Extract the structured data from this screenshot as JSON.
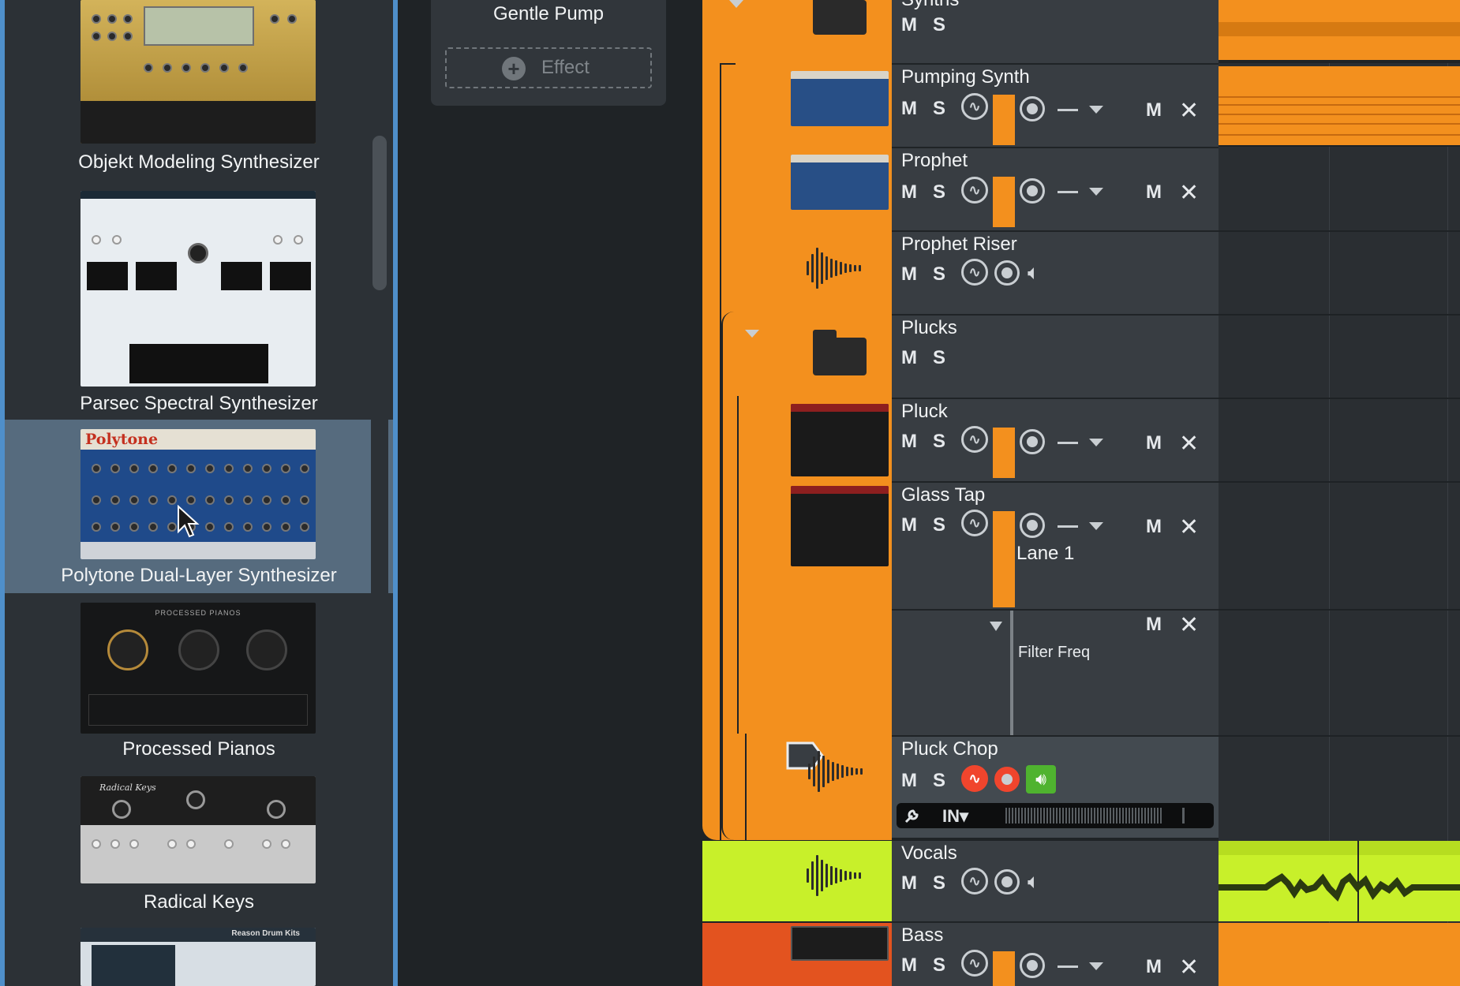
{
  "browser": {
    "plugins": [
      {
        "name": "Objekt Modeling Synthesizer",
        "selected": false
      },
      {
        "name": "Parsec Spectral Synthesizer",
        "selected": false
      },
      {
        "name": "Polytone Dual-Layer Synthesizer",
        "selected": true,
        "logo": "Polytone"
      },
      {
        "name": "Processed Pianos",
        "selected": false,
        "panel_title": "PROCESSED PIANOS"
      },
      {
        "name": "Radical Keys",
        "selected": false,
        "panel_title": "Radical Keys"
      },
      {
        "name": "Reason Drum Kits",
        "selected": false,
        "panel_title": "Reason Drum Kits"
      }
    ]
  },
  "fx_panel": {
    "title": "Gentle Pump",
    "add_effect_label": "Effect"
  },
  "tracks": {
    "mute_label": "M",
    "solo_label": "S",
    "close_label": "✕",
    "items": [
      {
        "name": "Synths",
        "type": "folder"
      },
      {
        "name": "Pumping Synth",
        "type": "instrument"
      },
      {
        "name": "Prophet",
        "type": "instrument"
      },
      {
        "name": "Prophet Riser",
        "type": "audio"
      },
      {
        "name": "Plucks",
        "type": "folder"
      },
      {
        "name": "Pluck",
        "type": "instrument"
      },
      {
        "name": "Glass Tap",
        "type": "instrument",
        "lane_label": "Lane 1",
        "automation_label": "Filter Freq"
      },
      {
        "name": "Pluck Chop",
        "type": "audio",
        "input_label": "IN▾"
      },
      {
        "name": "Vocals",
        "type": "audio"
      },
      {
        "name": "Bass",
        "type": "instrument"
      }
    ]
  },
  "colors": {
    "orange": "#f3901e",
    "lime": "#c8f02a",
    "bass_red": "#e3531f",
    "selection_blue": "#566b7e",
    "record_red": "#f0452d",
    "monitor_green": "#4fb32f"
  }
}
